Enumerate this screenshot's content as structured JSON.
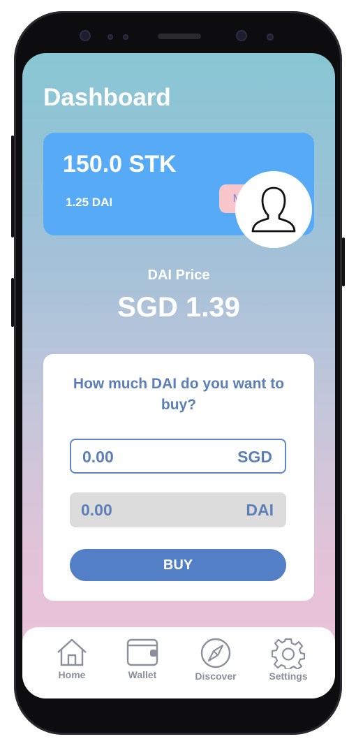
{
  "header": {
    "title": "Dashboard"
  },
  "balance_card": {
    "stk_balance": "150.0 STK",
    "dai_balance": "1.25 DAI",
    "manage_label": "Manage",
    "avatar_icon": "user-silhouette-icon"
  },
  "price": {
    "label": "DAI Price",
    "value": "SGD 1.39"
  },
  "buy": {
    "question": "How much DAI do you want to buy?",
    "sgd_value": "0.00",
    "sgd_unit": "SGD",
    "dai_value": "0.00",
    "dai_unit": "DAI",
    "buy_label": "BUY"
  },
  "nav": {
    "items": [
      {
        "label": "Home",
        "icon": "home-icon"
      },
      {
        "label": "Wallet",
        "icon": "wallet-icon"
      },
      {
        "label": "Discover",
        "icon": "compass-icon"
      },
      {
        "label": "Settings",
        "icon": "gear-icon"
      }
    ]
  },
  "colors": {
    "card_blue": "#57aaf6",
    "accent_blue": "#537fc7",
    "text_blue": "#5c7fb8",
    "manage_pink": "#f9c6cc"
  }
}
